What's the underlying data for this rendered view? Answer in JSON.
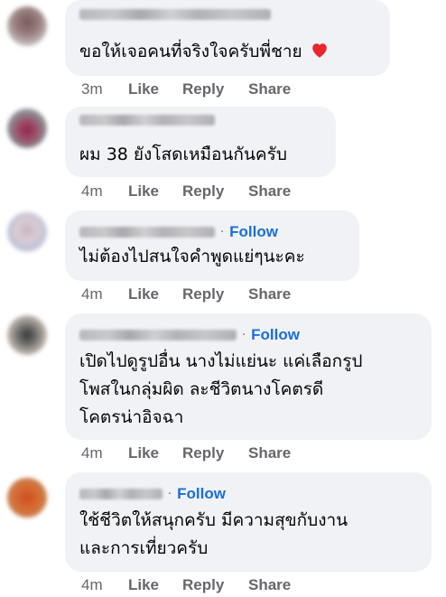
{
  "comments": [
    {
      "text_lines": [
        "ขอให้เจอคนที่จริงใจครับพี่ชาย"
      ],
      "has_heart": true,
      "follow": "",
      "time": "3m"
    },
    {
      "text_lines": [
        "ผม 38 ยังโสดเหมือนกันครับ"
      ],
      "has_heart": false,
      "follow": "",
      "time": "4m"
    },
    {
      "text_lines": [
        "ไม่ต้องไปสนใจคำพูดแย่ๆนะคะ"
      ],
      "has_heart": false,
      "follow": "Follow",
      "time": "4m"
    },
    {
      "text_lines": [
        "เปิดไปดูรูปอื่น นางไม่แย่นะ แค่เลือกรูป",
        "โพสในกลุ่มผิด ละชีวิตนางโคตรดี",
        "โคตรน่าอิจฉา"
      ],
      "has_heart": false,
      "follow": "Follow",
      "time": "4m"
    },
    {
      "text_lines": [
        "ใช้ชีวิตให้สนุกครับ มีความสุขกับงาน",
        "และการเที่ยวครับ"
      ],
      "has_heart": false,
      "follow": "Follow",
      "time": "4m"
    }
  ],
  "actions": {
    "like": "Like",
    "reply": "Reply",
    "share": "Share"
  },
  "colors": {
    "bubble": "#f0f2f5",
    "follow": "#1a6fd8",
    "meta": "#65676b",
    "heart": "#e8262d"
  }
}
